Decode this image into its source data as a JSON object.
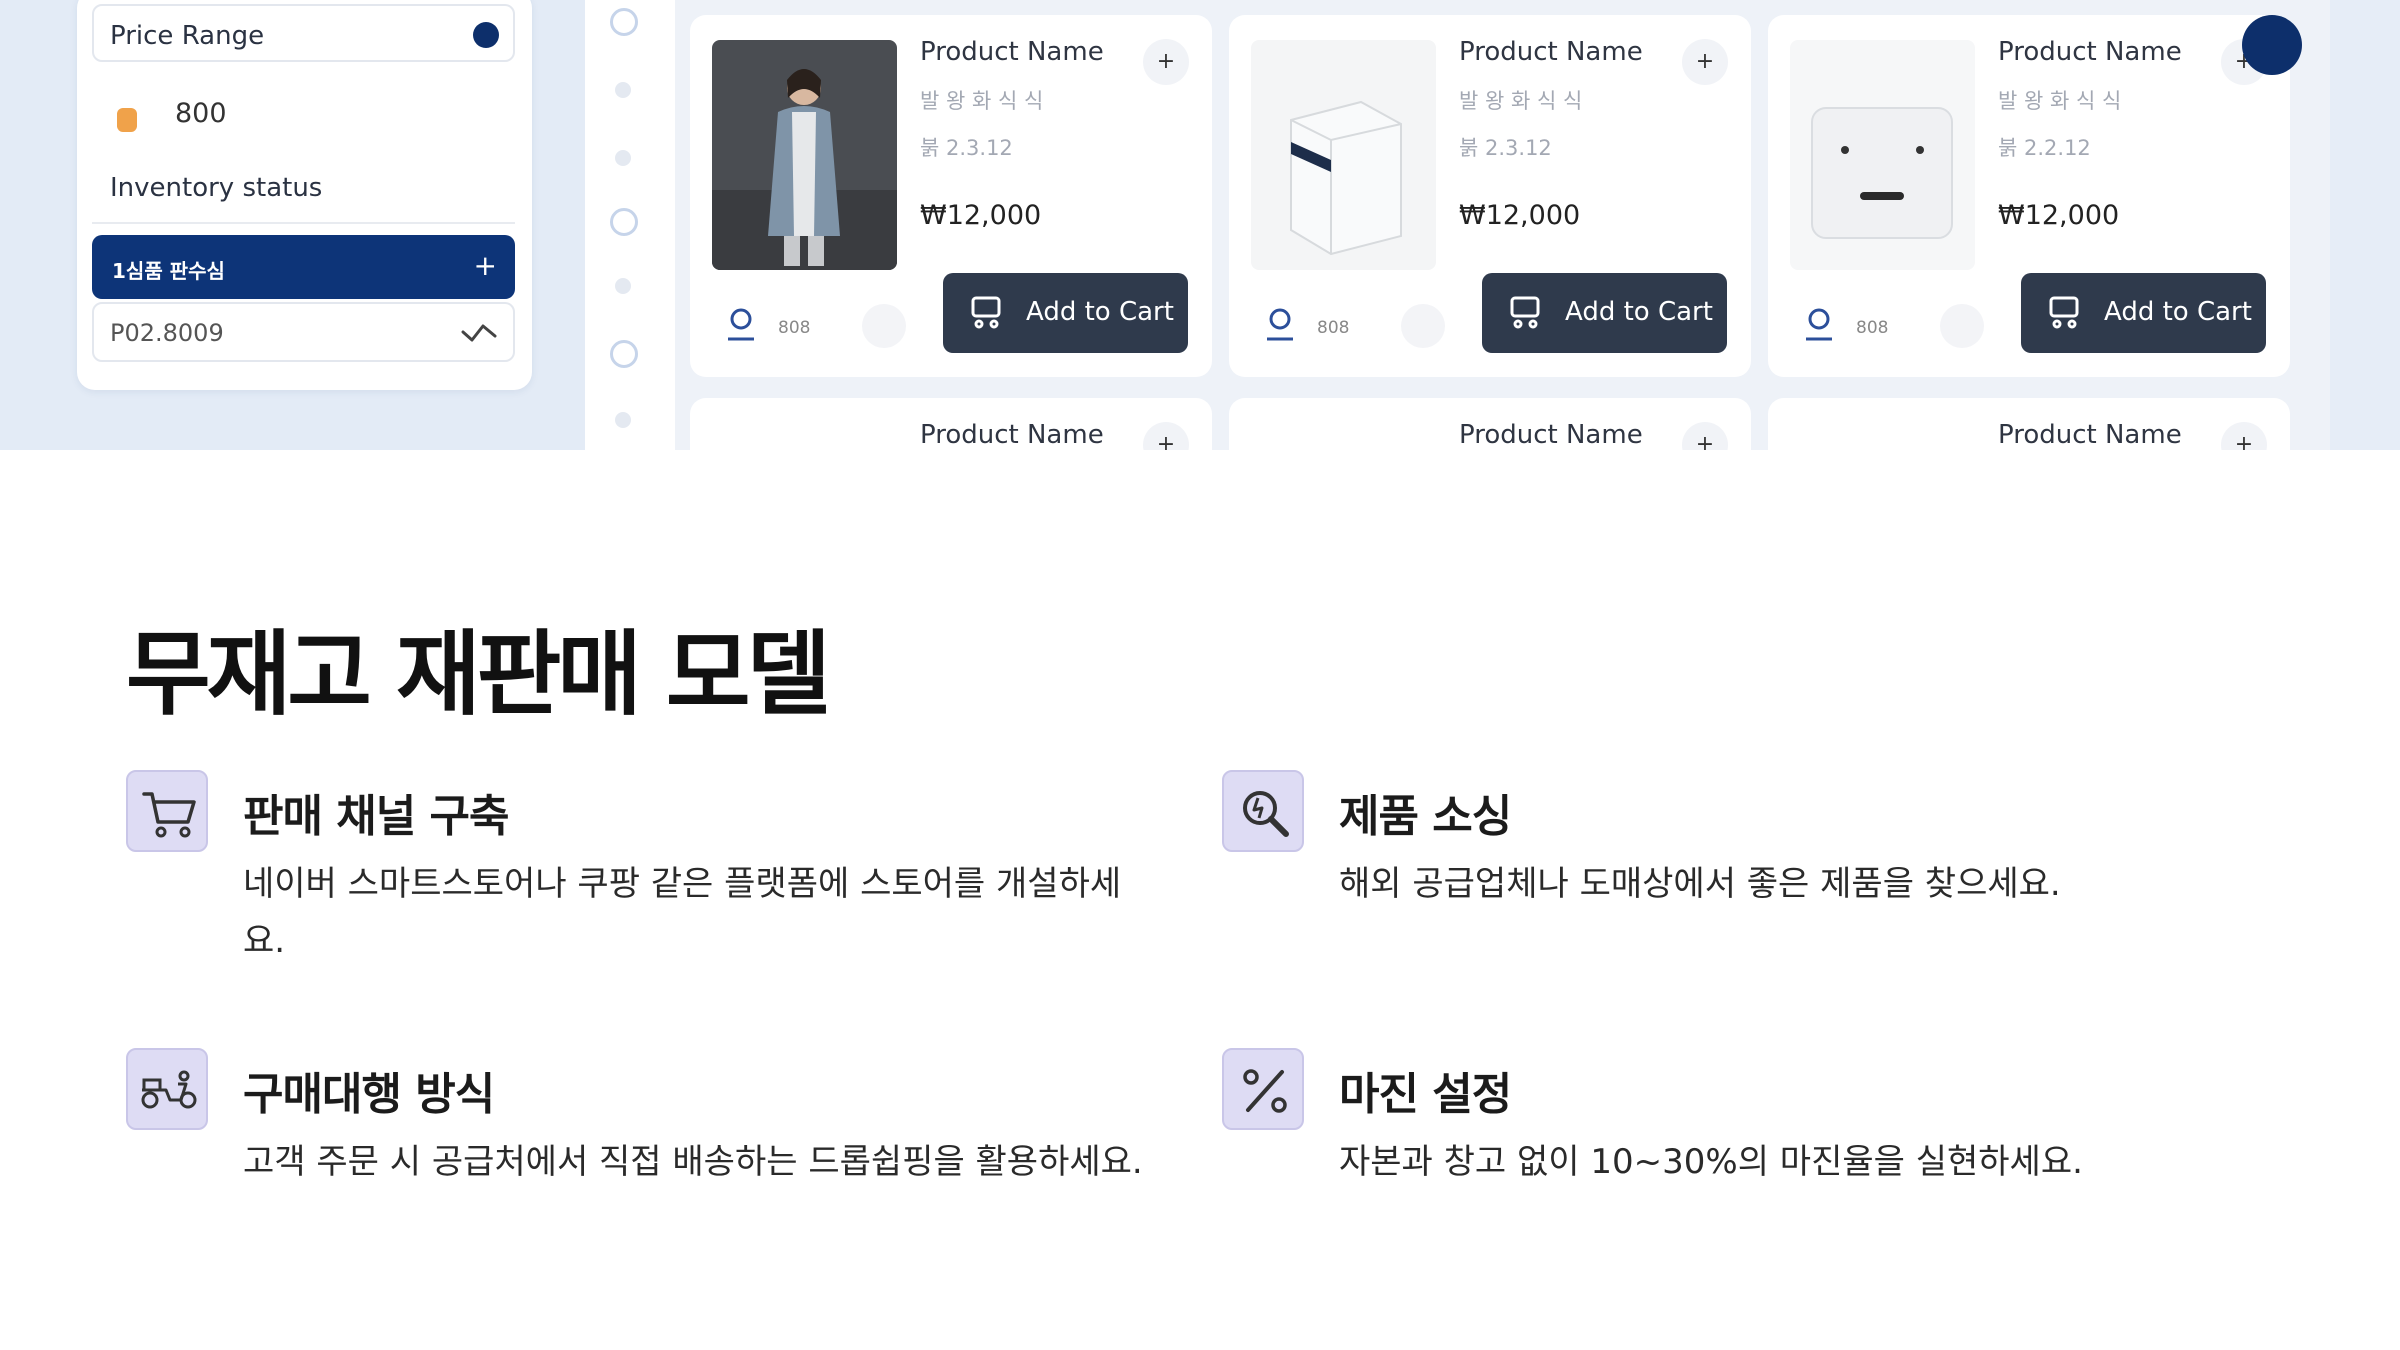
{
  "filter": {
    "price_range_label": "Price Range",
    "price_value": "800",
    "inventory_label": "Inventory status",
    "inventory_selected": "1심품 판수심",
    "inventory_field_value": "P02.8009"
  },
  "products": [
    {
      "name": "Product Name",
      "sub1": "발 왕 화 식 식",
      "sub2": "붉 2.3.12",
      "price": "₩12,000",
      "count": "808",
      "cart_label": "Add to Cart",
      "image": "woman-in-jacket"
    },
    {
      "name": "Product Name",
      "sub1": "발 왕 화 식 식",
      "sub2": "붉 2.3.12",
      "price": "₩12,000",
      "count": "808",
      "cart_label": "Add to Cart",
      "image": "white-box"
    },
    {
      "name": "Product Name",
      "sub1": "발 왕 화 식 식",
      "sub2": "붉 2.2.12",
      "price": "₩12,000",
      "count": "808",
      "cart_label": "Add to Cart",
      "image": "white-device"
    },
    {
      "name": "Product Name"
    },
    {
      "name": "Product Name"
    },
    {
      "name": "Product Name"
    }
  ],
  "slide": {
    "title": "무재고 재판매 모델",
    "features": [
      {
        "icon": "cart-icon",
        "title": "판매 채널 구축",
        "desc_line1": "네이버 스마트스토어나 쿠팡 같은 플랫폼에 스토어를 개설하세",
        "desc_line2": "요."
      },
      {
        "icon": "search-tool-icon",
        "title": "제품 소싱",
        "desc_line1": "해외 공급업체나 도매상에서 좋은 제품을 찾으세요.",
        "desc_line2": ""
      },
      {
        "icon": "delivery-scooter-icon",
        "title": "구매대행 방식",
        "desc_line1": "고객 주문 시 공급처에서 직접 배송하는 드롭쉽핑을 활용하세요.",
        "desc_line2": ""
      },
      {
        "icon": "percent-icon",
        "title": "마진 설정",
        "desc_line1": "자본과 창고 없이 10~30%의 마진율을 실현하세요.",
        "desc_line2": ""
      }
    ]
  },
  "colors": {
    "accent": "#0d3478",
    "button": "#2f3a4c",
    "icon_bg": "#dedcf4"
  }
}
